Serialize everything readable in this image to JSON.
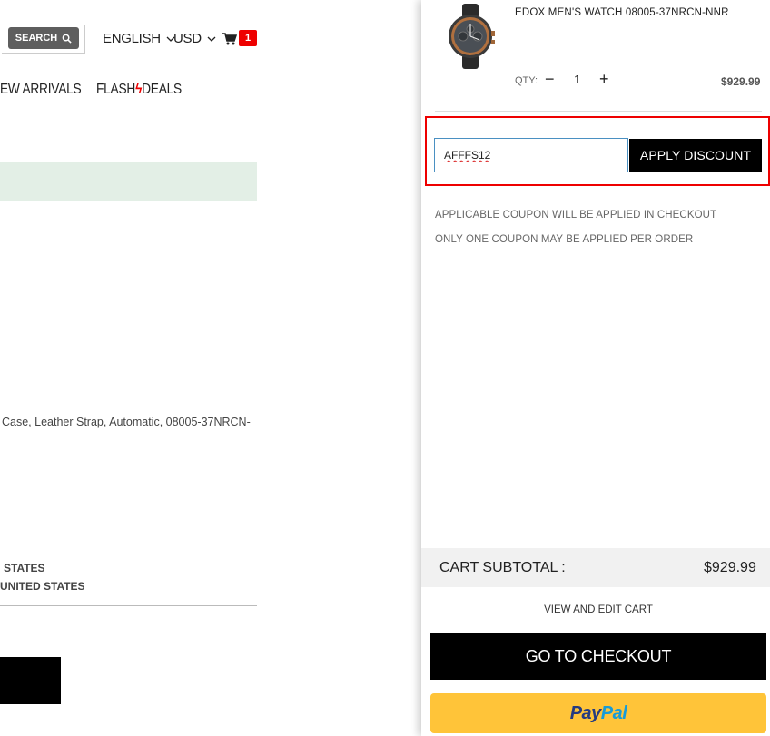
{
  "header": {
    "search_label": "SEARCH",
    "language": "ENGLISH",
    "currency": "USD",
    "cart_count": "1"
  },
  "nav": {
    "new_arrivals": "EW ARRIVALS",
    "flash_part1": "FLASH",
    "flash_part2": "DEALS"
  },
  "background_page": {
    "product_description": "Case, Leather Strap, Automatic, 08005-37NRCN-",
    "ship_line_1": "STATES",
    "ship_line_2": "UNITED STATES"
  },
  "cart": {
    "item": {
      "name": "EDOX MEN'S WATCH 08005-37NRCN-NNR",
      "qty_label": "QTY:",
      "qty_value": "1",
      "price": "$929.99"
    },
    "coupon": {
      "value": "AFFFS12",
      "apply_label": "APPLY DISCOUNT"
    },
    "notes": [
      "APPLICABLE COUPON WILL BE APPLIED IN CHECKOUT",
      "ONLY ONE COUPON MAY BE APPLIED PER ORDER"
    ],
    "subtotal_label": "CART SUBTOTAL :",
    "subtotal_value": "$929.99",
    "view_edit_label": "VIEW AND EDIT CART",
    "checkout_label": "GO TO CHECKOUT",
    "paypal_part1": "Pay",
    "paypal_part2": "Pal"
  },
  "colors": {
    "accent_red": "#e00000",
    "paypal_yellow": "#ffc439",
    "paypal_dark_blue": "#253b80",
    "paypal_light_blue": "#179bd7",
    "notice_green": "#e3efe6"
  },
  "icons": [
    "search-icon",
    "chevron-down-icon",
    "cart-icon",
    "minus-icon",
    "plus-icon",
    "watch-image"
  ]
}
